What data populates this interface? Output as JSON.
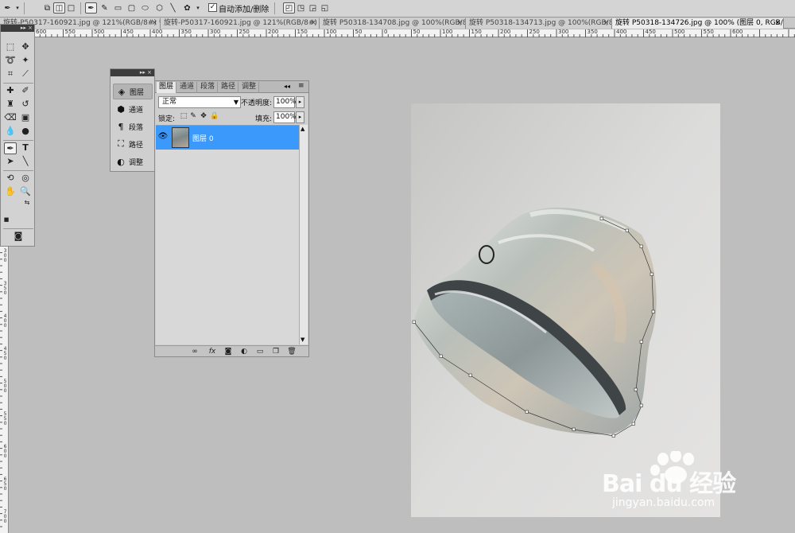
{
  "options_bar": {
    "auto_add_delete_checked": "✓",
    "auto_add_delete_label": "自动添加/删除"
  },
  "tabs": [
    {
      "label": "旋转-P50317-160921.jpg @ 121%(RGB/8#) *",
      "close": "×"
    },
    {
      "label": "旋转-P50317-160921.jpg @ 121%(RGB/8#) *",
      "close": "×"
    },
    {
      "label": "旋转 P50318-134708.jpg @ 100%(RGB/8)",
      "close": "×"
    },
    {
      "label": "旋转 P50318-134713.jpg @ 100%(RGB/8)",
      "close": "×"
    },
    {
      "label": "旋转 P50318-134726.jpg @ 100% (图层 0, RGB/8) *",
      "close": "×"
    }
  ],
  "ruler": {
    "h": [
      "600",
      "550",
      "500",
      "450",
      "400",
      "350",
      "300",
      "250",
      "200",
      "150",
      "100",
      "50",
      "0",
      "50",
      "100",
      "150",
      "200",
      "250",
      "300",
      "350",
      "400",
      "450",
      "500",
      "550",
      "600"
    ],
    "v": [
      "250",
      "300",
      "350",
      "400",
      "450",
      "500",
      "550",
      "600",
      "650",
      "700"
    ]
  },
  "dock": {
    "items": [
      {
        "label": "图层",
        "icon": "layers-icon"
      },
      {
        "label": "通道",
        "icon": "channels-icon"
      },
      {
        "label": "段落",
        "icon": "paragraph-icon"
      },
      {
        "label": "路径",
        "icon": "paths-icon"
      },
      {
        "label": "调整",
        "icon": "adjustments-icon"
      }
    ]
  },
  "layers_panel": {
    "tabs": [
      "图层",
      "通道",
      "段落",
      "路径",
      "调整"
    ],
    "blend_mode": "正常",
    "opacity_label": "不透明度:",
    "opacity_value": "100%",
    "lock_label": "锁定:",
    "fill_label": "填充:",
    "fill_value": "100%",
    "layer_name": "图层 0"
  },
  "watermark": {
    "brand": "Bai du 经验",
    "url": "jingyan.baidu.com"
  },
  "colors": {
    "selection": "#3b99fc",
    "background_swatch": "#7d5d57",
    "foreground_swatch": "#f4f4f4",
    "workspace": "#bebebe"
  }
}
